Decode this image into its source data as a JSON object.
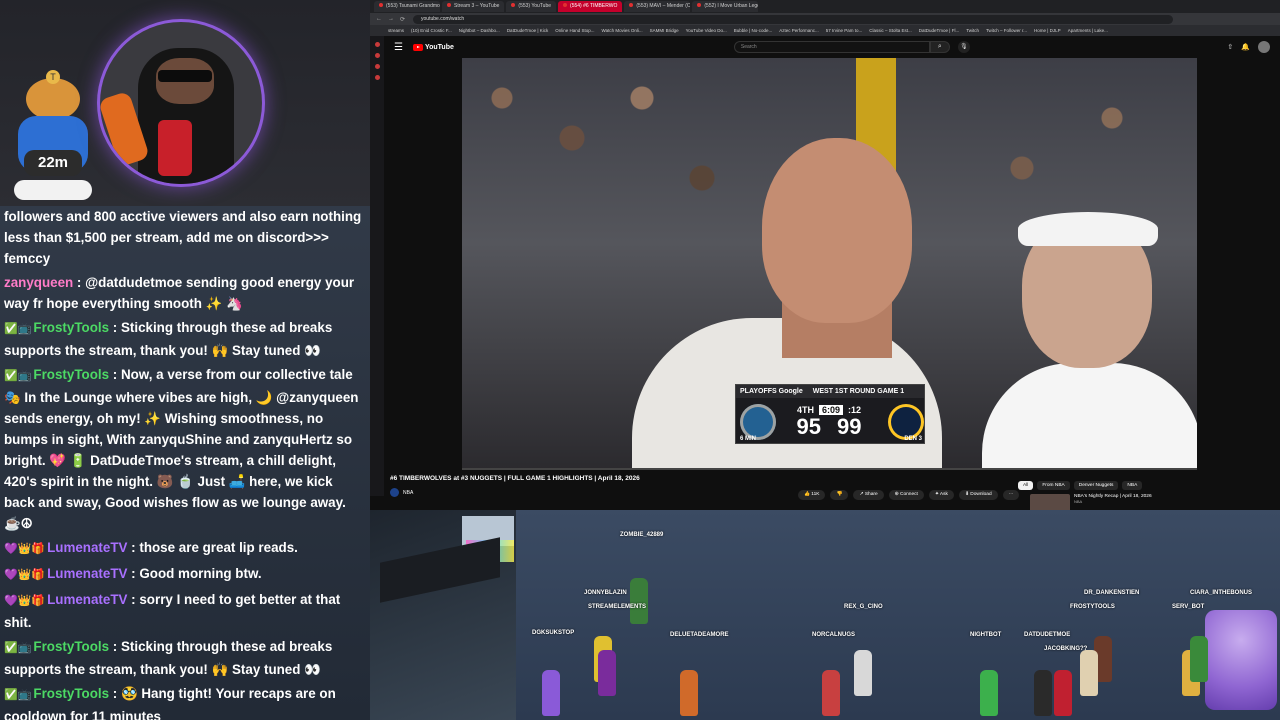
{
  "stream": {
    "followers_badge": "22m",
    "chat": [
      {
        "user": "",
        "text": "followers and 800 acctive viewers and also earn nothing less than $1,500 per stream, add me on discord>>> femccy",
        "color": "#ffffff"
      },
      {
        "user": "zanyqueen",
        "text": "@datdudetmoe sending good energy your way fr hope everything smooth ✨ 🦄",
        "color": "#ff7cc8",
        "badges": ""
      },
      {
        "user": "FrostyTools",
        "text": "Sticking through these ad breaks supports the stream, thank you! 🙌 Stay tuned 👀",
        "color": "#4cd964",
        "badges": "✅📺"
      },
      {
        "user": "FrostyTools",
        "text": "Now, a verse from our collective tale 🎭 In the Lounge where vibes are high, 🌙 @zanyqueen sends energy, oh my! ✨ Wishing smoothness, no bumps in sight, With zanyquShine and zanyquHertz so bright. 💖 🔋 DatDudeTmoe's stream, a chill delight, 420's spirit in the night. 🐻 🍵 Just 🛋️ here, we kick back and sway, Good wishes flow as we lounge away. ☕☮",
        "color": "#4cd964",
        "badges": "✅📺"
      },
      {
        "user": "LumenateTV",
        "text": "those are great lip reads.",
        "color": "#a970ff",
        "badges": "💜👑🎁"
      },
      {
        "user": "LumenateTV",
        "text": "Good morning btw.",
        "color": "#a970ff",
        "badges": "💜👑🎁"
      },
      {
        "user": "LumenateTV",
        "text": "sorry I need to get better at that shit.",
        "color": "#a970ff",
        "badges": "💜👑🎁"
      },
      {
        "user": "FrostyTools",
        "text": "Sticking through these ad breaks supports the stream, thank you! 🙌 Stay tuned 👀",
        "color": "#4cd964",
        "badges": "✅📺"
      },
      {
        "user": "FrostyTools",
        "text": "🥸 Hang tight! Your recaps are on cooldown for 11 minutes",
        "color": "#4cd964",
        "badges": "✅📺"
      }
    ]
  },
  "browser": {
    "tabs": [
      {
        "label": "(553) Tsunami Grandmo",
        "active": false
      },
      {
        "label": "Stream 3 – YouTube",
        "active": false
      },
      {
        "label": "(553) YouTube",
        "active": false
      },
      {
        "label": "(554) #6 TIMBERWO",
        "active": true
      },
      {
        "label": "(553) MAVI – Mender (O",
        "active": false
      },
      {
        "label": "(552) I Move Urban Lege",
        "active": false
      }
    ],
    "url": "youtube.com/watch",
    "bookmarks": [
      "streams",
      "(10) Enid Crostic F...",
      "Nightbot – Dashbo...",
      "DatDudeTmoe | Kick",
      "Online Hand Stop...",
      "Watch Movies Onli...",
      "SAMMI Bridge",
      "YouTube Video Do...",
      "Bubble | No-code...",
      "Aztec Performanc...",
      "57 Irvine Pam to...",
      "Classic – Stolta Est...",
      "DatDudeTmoe | Fl...",
      "Twitch",
      "Twitch – Follower r...",
      "Home | DJLP",
      "Apartments | Lake..."
    ]
  },
  "youtube": {
    "logo_text": "YouTube",
    "search_placeholder": "Search",
    "video_title": "#6 TIMBERWOLVES at #3 NUGGETS | FULL GAME 1 HIGHLIGHTS | April 18, 2026",
    "channel_name": "NBA",
    "actions": [
      "👍 11K",
      "👎",
      "↗ Share",
      "⊕ Connect",
      "✦ Ask",
      "⬇ Download",
      "···"
    ],
    "chips": [
      {
        "label": "All",
        "active": true
      },
      {
        "label": "From NBA",
        "active": false
      },
      {
        "label": "Denver Nuggets",
        "active": false
      },
      {
        "label": "NBA",
        "active": false
      }
    ],
    "recommended": {
      "title": "NBA's Nightly Recap | April 18, 2026",
      "channel": "NBA"
    },
    "progress": 0.0
  },
  "scorebug": {
    "header": "PLAYOFFS Google",
    "round": "WEST 1ST ROUND GAME 1",
    "quarter": "4TH",
    "clock": "6:09",
    "shot_clock": ":12",
    "away_score": "95",
    "home_score": "99",
    "away_abbr": "MIN",
    "home_abbr": "DEN",
    "away_seed": "6",
    "home_seed": "3",
    "colors": {
      "wolves": "#236192",
      "nuggets": "#0e2240",
      "nuggets_gold": "#fec524"
    }
  },
  "avatars": [
    {
      "name": "ZOMBIE_42889"
    },
    {
      "name": "JONNYBLAZIN"
    },
    {
      "name": "STREAMELEMENTS"
    },
    {
      "name": "REX_G_CINO"
    },
    {
      "name": "NORCALNUGS"
    },
    {
      "name": "DELUETADEAMORE"
    },
    {
      "name": "DGKSUKSTOP"
    },
    {
      "name": "NIGHTBOT"
    },
    {
      "name": "DATDUDETMOE"
    },
    {
      "name": "JACOBKING??"
    },
    {
      "name": "DR_DANKENSTIEN"
    },
    {
      "name": "FROSTYTOOLS"
    },
    {
      "name": "SERV_BOT"
    },
    {
      "name": "CIARA_INTHEBONUS"
    }
  ]
}
